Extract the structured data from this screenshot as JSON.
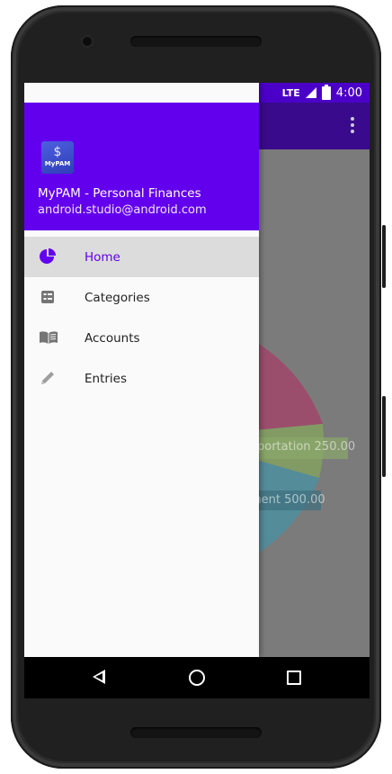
{
  "status_bar": {
    "time": "4:00",
    "network": "LTE"
  },
  "drawer": {
    "header": {
      "logo_symbol": "$",
      "logo_text": "MyPAM",
      "app_name": "MyPAM - Personal Finances",
      "email": "android.studio@android.com"
    },
    "menu": [
      {
        "label": "Home",
        "icon": "pie-chart-icon",
        "active": true
      },
      {
        "label": "Categories",
        "icon": "list-icon",
        "active": false
      },
      {
        "label": "Accounts",
        "icon": "book-icon",
        "active": false
      },
      {
        "label": "Entries",
        "icon": "pencil-icon",
        "active": false
      }
    ]
  },
  "chart_data": {
    "type": "pie",
    "slices": [
      {
        "label": "Transportation",
        "value": 250.0,
        "color": "#8bc34a"
      },
      {
        "label": "Entertainment",
        "value": 500.0,
        "color": "#26a2c0"
      },
      {
        "label": "",
        "value": null,
        "color": "#c2185b"
      }
    ],
    "visible_labels": [
      "portation 250.00",
      "ment 500.00"
    ]
  },
  "colors": {
    "primary": "#6200ee",
    "primary_dark": "#3700b3",
    "scrim": "#7b7b7b"
  }
}
